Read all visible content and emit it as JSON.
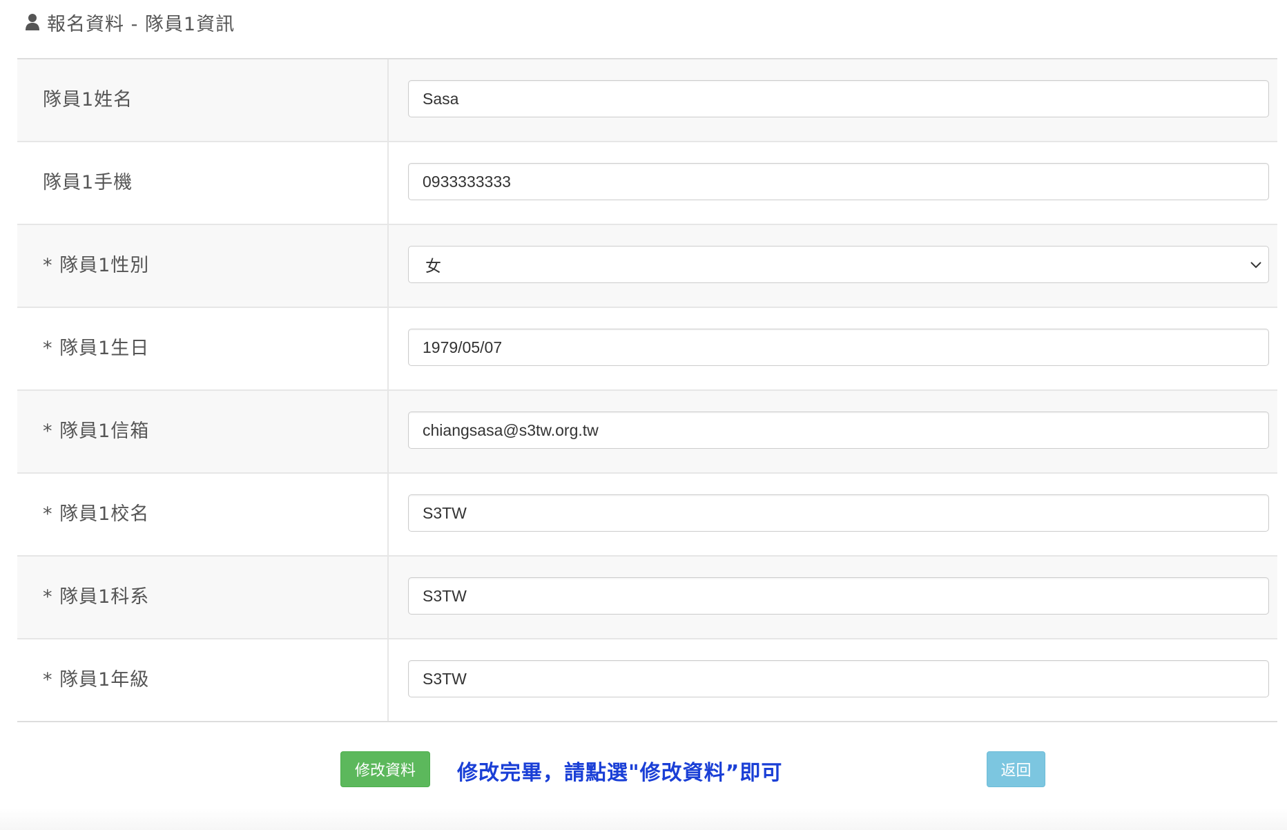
{
  "section": {
    "title": "報名資料 - 隊員1資訊",
    "icon": "user-icon"
  },
  "fields": [
    {
      "label": "隊員1姓名",
      "value": "Sasa",
      "type": "text"
    },
    {
      "label": "隊員1手機",
      "value": "0933333333",
      "type": "text"
    },
    {
      "label": "* 隊員1性別",
      "value": "女",
      "type": "select"
    },
    {
      "label": "* 隊員1生日",
      "value": "1979/05/07",
      "type": "text"
    },
    {
      "label": "* 隊員1信箱",
      "value": "chiangsasa@s3tw.org.tw",
      "type": "text"
    },
    {
      "label": "* 隊員1校名",
      "value": "S3TW",
      "type": "text"
    },
    {
      "label": "* 隊員1科系",
      "value": "S3TW",
      "type": "text"
    },
    {
      "label": "* 隊員1年級",
      "value": "S3TW",
      "type": "text"
    }
  ],
  "actions": {
    "save_label": "修改資料",
    "hint": "修改完畢，請點選\"修改資料”即可",
    "back_label": "返回"
  },
  "colors": {
    "save_button": "#5cb85c",
    "back_button": "#7cc6e0",
    "hint_text": "#1a3fd6",
    "row_alt": "#f8f8f8"
  }
}
